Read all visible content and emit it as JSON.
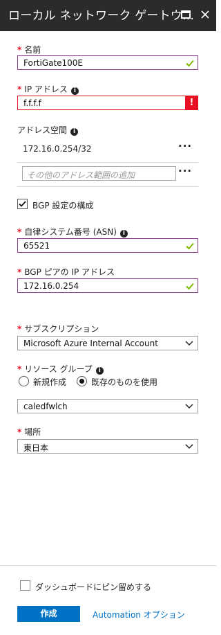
{
  "title": "ローカル ネットワーク ゲートウ…",
  "fields": {
    "name": {
      "label": "名前",
      "value": "FortiGate100E"
    },
    "ip": {
      "label": "IP アドレス",
      "value": "f.f.f.f",
      "error_mark": "!"
    },
    "address_space": {
      "label": "アドレス空間",
      "value": "172.16.0.254/32",
      "placeholder": "その他のアドレス範囲の追加",
      "more": "···"
    },
    "bgp": {
      "label": "BGP 設定の構成",
      "checked": true
    },
    "asn": {
      "label": "自律システム番号 (ASN)",
      "value": "65521"
    },
    "bgp_peer": {
      "label": "BGP ピアの IP アドレス",
      "value": "172.16.0.254"
    },
    "subscription": {
      "label": "サブスクリプション",
      "value": "Microsoft Azure Internal Account"
    },
    "resource_group": {
      "label": "リソース グループ",
      "option_new": "新規作成",
      "option_existing": "既存のものを使用",
      "selected": "existing",
      "value": "caledfwlch"
    },
    "location": {
      "label": "場所",
      "value": "東日本"
    }
  },
  "footer": {
    "pin_label": "ダッシュボードにピン留めする",
    "create_label": "作成",
    "automation_label": "Automation オプション"
  },
  "colors": {
    "accent": "#0072c6",
    "error": "#e81123",
    "valid": "#7fba00",
    "focus_border": "#8b3a8b",
    "titlebar": "#2b2b2b"
  }
}
